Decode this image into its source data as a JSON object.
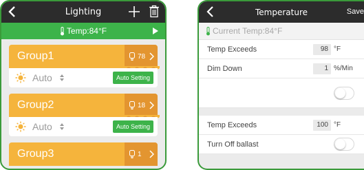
{
  "lighting": {
    "title": "Lighting",
    "temp_label": "Temp:84°F",
    "groups": [
      {
        "name": "Group1",
        "count": "78",
        "mode": "Auto",
        "button": "Auto Setting"
      },
      {
        "name": "Group2",
        "count": "18",
        "mode": "Auto",
        "button": "Auto Setting"
      },
      {
        "name": "Group3",
        "count": "1"
      }
    ]
  },
  "temperature": {
    "title": "Temperature",
    "save_label": "Save",
    "current_temp": "Current Temp:84°F",
    "rows": [
      {
        "label": "Temp Exceeds",
        "value": "98",
        "unit": "°F"
      },
      {
        "label": "Dim Down",
        "value": "1",
        "unit": "%/Min"
      },
      {
        "toggle_on": false
      },
      {
        "label": "Temp Exceeds",
        "value": "100",
        "unit": "°F"
      },
      {
        "label": "Turn Off ballast",
        "toggle_on": false
      }
    ]
  },
  "colors": {
    "green": "#3db34a",
    "orange": "#f5b43c",
    "orange_dark": "#e39530",
    "header": "#2c2c2c"
  }
}
